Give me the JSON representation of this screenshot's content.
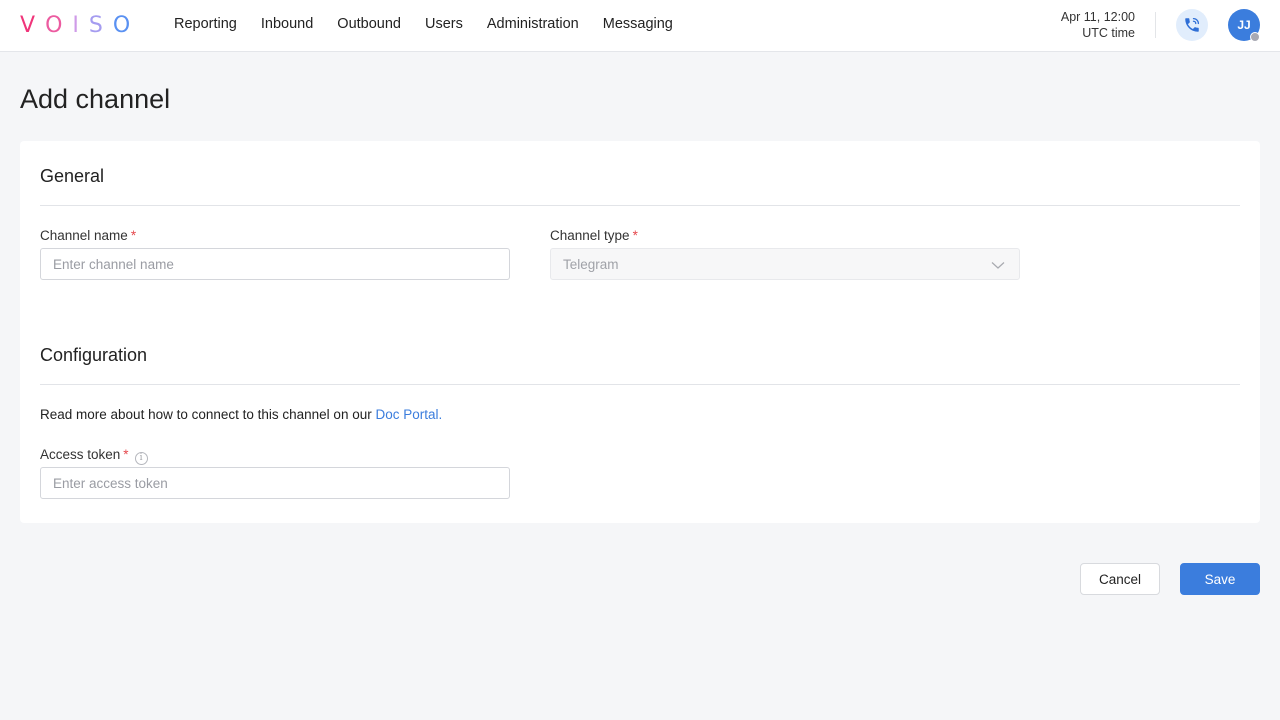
{
  "brand": {
    "logo_letters": [
      "V",
      "O",
      "I",
      "S",
      "O"
    ],
    "logo_colors": [
      "#f0357a",
      "#ec5ba0",
      "#cf9be8",
      "#a59cf0",
      "#5a91f2"
    ]
  },
  "nav": {
    "items": [
      {
        "label": "Reporting"
      },
      {
        "label": "Inbound"
      },
      {
        "label": "Outbound"
      },
      {
        "label": "Users"
      },
      {
        "label": "Administration"
      },
      {
        "label": "Messaging"
      }
    ]
  },
  "header": {
    "clock_date": "Apr 11, 12:00",
    "clock_zone": "UTC time",
    "phone_icon": "phone-ringing-icon",
    "avatar_initials": "JJ",
    "avatar_status": "offline"
  },
  "page": {
    "title": "Add channel"
  },
  "general": {
    "title": "General",
    "channel_name_label": "Channel name",
    "channel_name_required": "*",
    "channel_name_value": "",
    "channel_name_placeholder": "Enter channel name",
    "channel_type_label": "Channel type",
    "channel_type_required": "*",
    "channel_type_value": "Telegram"
  },
  "configuration": {
    "title": "Configuration",
    "info_text": "Read more about how to connect to this channel on our ",
    "doc_link": "Doc Portal.",
    "access_token_label": "Access token",
    "access_token_required": "*",
    "access_token_info_icon": "i",
    "access_token_value": "",
    "access_token_placeholder": "Enter access token"
  },
  "actions": {
    "cancel_label": "Cancel",
    "save_label": "Save"
  },
  "colors": {
    "accent": "#3b7ddd",
    "required": "#e5484d",
    "background": "#f5f6f8"
  }
}
